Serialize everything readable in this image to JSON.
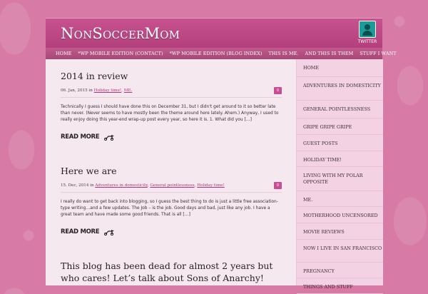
{
  "header": {
    "site_title": "NonSoccerMom",
    "twitter_label": "TWITTER"
  },
  "nav": {
    "items": [
      "HOME",
      "*WP MOBILE EDITION (CONTACT)",
      "*WP MOBILE EDITION (BLOG INDEX)",
      "THIS IS ME.",
      "AND THIS IS THEM",
      "STUFF I WANT"
    ]
  },
  "posts": [
    {
      "title": "2014 in review",
      "date": "06. Jan, 2015 in ",
      "categories": [
        "Holiday time!",
        "ME."
      ],
      "comments": "0",
      "excerpt": "Technically I guess I should have done this on December 31, but I didn't get around to it so better late than never. (Never seems to have mostly been the theme around here lately. Ahem.) Anyway, I used to really enjoy doing this year-end wrap-up post every year, so here it is. 1. What did you […]",
      "read_more": "Read More"
    },
    {
      "title": "Here we are",
      "date": "15. Dec, 2014 in ",
      "categories": [
        "Adventures in domesticity",
        "General pointlessness",
        "Holiday time!"
      ],
      "comments": "0",
      "excerpt": "I really do want to get back into blogging, so I guess the best thing to do is just a little free association-type writing…and a few updates. The Job – is the job. Good days and bad, just like any job. I have a great team and have made some good friends. That is all […]",
      "read_more": "Read More"
    },
    {
      "title": "This blog has been dead for almost 2 years but who cares! Let’s talk about Sons of Anarchy!"
    }
  ],
  "sidebar": {
    "items": [
      "HOME",
      "ADVENTURES IN DOMESTICITY",
      "GENERAL POINTLESSNESS",
      "GRIPE GRIPE GRIPE",
      "GUEST POSTS",
      "HOLIDAY TIME!",
      "LIVING WITH MY POLAR OPPOSITE",
      "ME.",
      "MOTHERHOOD UNCENSORED",
      "MOVIE REVIEWS",
      "NOW I LIVE IN SAN FRANCISCO",
      "PREGNANCY",
      "THINGS AND STUFF"
    ]
  },
  "colors": {
    "background": "#d77aa6",
    "header": "#b8417f",
    "link": "#b0337a",
    "comment_badge": "#c84d93"
  },
  "icons": {
    "twitter": "twitter-avatar-icon",
    "read_more": "scooter-arrow-icon"
  }
}
